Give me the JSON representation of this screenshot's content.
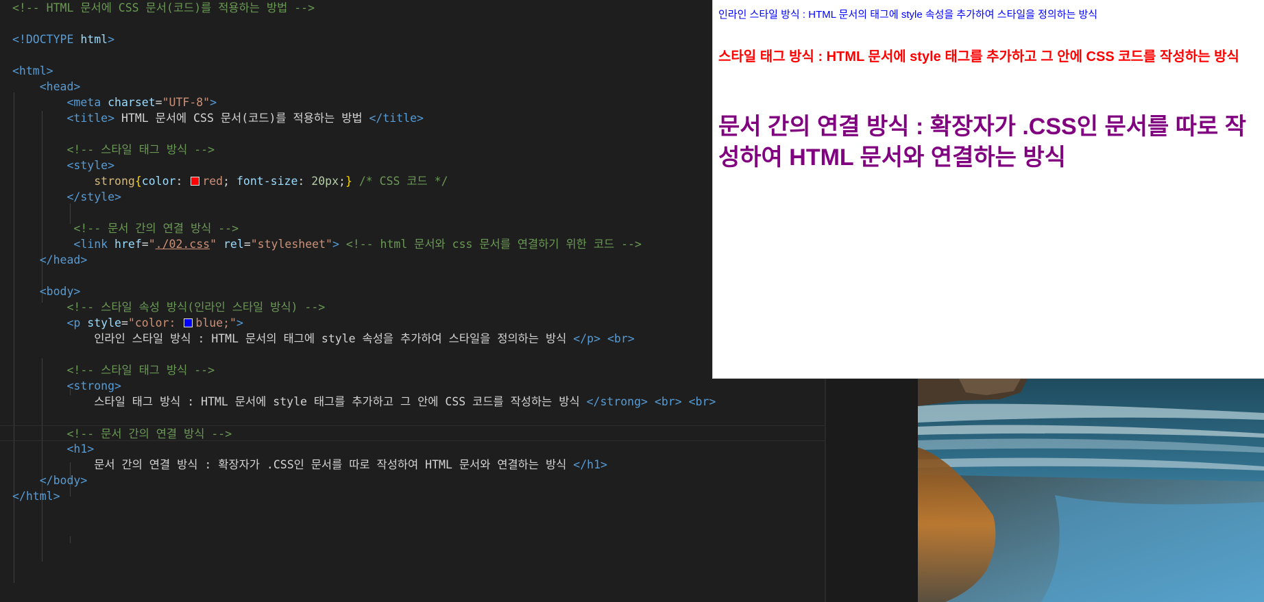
{
  "editor": {
    "lines": [
      [
        [
          "com",
          "<!-- HTML 문서에 CSS 문서(코드)를 적용하는 방법 -->"
        ]
      ],
      [],
      [
        [
          "tag",
          "<!"
        ],
        [
          "tag",
          "DOCTYPE"
        ],
        [
          "txt",
          " "
        ],
        [
          "attr",
          "html"
        ],
        [
          "tag",
          ">"
        ]
      ],
      [],
      [
        [
          "tag",
          "<html>"
        ]
      ],
      [
        [
          "txt",
          "    "
        ],
        [
          "tag",
          "<head>"
        ]
      ],
      [
        [
          "txt",
          "        "
        ],
        [
          "tag",
          "<meta"
        ],
        [
          "txt",
          " "
        ],
        [
          "attr",
          "charset"
        ],
        [
          "txt",
          "="
        ],
        [
          "str",
          "\"UTF-8\""
        ],
        [
          "tag",
          ">"
        ]
      ],
      [
        [
          "txt",
          "        "
        ],
        [
          "tag",
          "<title>"
        ],
        [
          "txt",
          " HTML 문서에 CSS 문서(코드)를 적용하는 방법 "
        ],
        [
          "tag",
          "</title>"
        ]
      ],
      [],
      [
        [
          "txt",
          "        "
        ],
        [
          "com",
          "<!-- 스타일 태그 방식 -->"
        ]
      ],
      [
        [
          "txt",
          "        "
        ],
        [
          "tag",
          "<style>"
        ]
      ],
      [
        [
          "txt",
          "            "
        ],
        [
          "sel",
          "strong"
        ],
        [
          "brace",
          "{"
        ],
        [
          "prop",
          "color"
        ],
        [
          "txt",
          ": "
        ],
        [
          "swatch",
          "#ff0000"
        ],
        [
          "str",
          "red"
        ],
        [
          "txt",
          "; "
        ],
        [
          "prop",
          "font-size"
        ],
        [
          "txt",
          ": "
        ],
        [
          "num",
          "20px"
        ],
        [
          "txt",
          ";"
        ],
        [
          "brace",
          "}"
        ],
        [
          "txt",
          " "
        ],
        [
          "com",
          "/* CSS 코드 */"
        ]
      ],
      [
        [
          "txt",
          "        "
        ],
        [
          "tag",
          "</style>"
        ]
      ],
      [],
      [
        [
          "txt",
          "         "
        ],
        [
          "com",
          "<!-- 문서 간의 연결 방식 -->"
        ]
      ],
      [
        [
          "txt",
          "         "
        ],
        [
          "tag",
          "<link"
        ],
        [
          "txt",
          " "
        ],
        [
          "attr",
          "href"
        ],
        [
          "txt",
          "="
        ],
        [
          "str",
          "\""
        ],
        [
          "link",
          "./02.css"
        ],
        [
          "str",
          "\""
        ],
        [
          "txt",
          " "
        ],
        [
          "attr",
          "rel"
        ],
        [
          "txt",
          "="
        ],
        [
          "str",
          "\"stylesheet\""
        ],
        [
          "tag",
          ">"
        ],
        [
          "txt",
          " "
        ],
        [
          "com",
          "<!-- html 문서와 css 문서를 연결하기 위한 코드 -->"
        ]
      ],
      [
        [
          "txt",
          "    "
        ],
        [
          "tag",
          "</head>"
        ]
      ],
      [],
      [
        [
          "txt",
          "    "
        ],
        [
          "tag",
          "<body>"
        ]
      ],
      [
        [
          "txt",
          "        "
        ],
        [
          "com",
          "<!-- 스타일 속성 방식(인라인 스타일 방식) -->"
        ]
      ],
      [
        [
          "txt",
          "        "
        ],
        [
          "tag",
          "<p"
        ],
        [
          "txt",
          " "
        ],
        [
          "attr",
          "style"
        ],
        [
          "txt",
          "="
        ],
        [
          "str",
          "\"color: "
        ],
        [
          "swatch",
          "#0000ff"
        ],
        [
          "str",
          "blue;\""
        ],
        [
          "tag",
          ">"
        ]
      ],
      [
        [
          "txt",
          "            인라인 스타일 방식 : HTML 문서의 태그에 style 속성을 추가하여 스타일을 정의하는 방식 "
        ],
        [
          "tag",
          "</p>"
        ],
        [
          "txt",
          " "
        ],
        [
          "tag",
          "<br>"
        ]
      ],
      [],
      [
        [
          "txt",
          "        "
        ],
        [
          "com",
          "<!-- 스타일 태그 방식 -->"
        ]
      ],
      [
        [
          "txt",
          "        "
        ],
        [
          "tag",
          "<strong>"
        ]
      ],
      [
        [
          "txt",
          "            스타일 태그 방식 : HTML 문서에 style 태그를 추가하고 그 안에 CSS 코드를 작성하는 방식 "
        ],
        [
          "tag",
          "</strong>"
        ],
        [
          "txt",
          " "
        ],
        [
          "tag",
          "<br>"
        ],
        [
          "txt",
          " "
        ],
        [
          "tag",
          "<br>"
        ]
      ],
      [],
      [
        [
          "txt",
          "        "
        ],
        [
          "com",
          "<!-- 문서 간의 연결 방식 -->"
        ]
      ],
      [
        [
          "txt",
          "        "
        ],
        [
          "tag",
          "<h1>"
        ]
      ],
      [
        [
          "txt",
          "            문서 간의 연결 방식 : 확장자가 .CSS인 문서를 따로 작성하여 HTML 문서와 연결하는 방식 "
        ],
        [
          "tag",
          "</h1>"
        ]
      ],
      [
        [
          "txt",
          "    "
        ],
        [
          "tag",
          "</body>"
        ]
      ],
      [
        [
          "tag",
          "</html>"
        ]
      ]
    ],
    "current_line": 27
  },
  "preview": {
    "inline_text": "인라인 스타일 방식 : HTML 문서의 태그에 style 속성을 추가하여 스타일을 정의하는 방식",
    "strong_text": "스타일 태그 방식 : HTML 문서에 style 태그를 추가하고 그 안에 CSS 코드를 작성하는 방식",
    "h1_text": "문서 간의 연결 방식 : 확장자가 .CSS인 문서를 따로 작성하여 HTML 문서와 연결하는 방식"
  },
  "colors": {
    "editor_bg": "#1e1e1e",
    "inline_blue": "#0000ff",
    "strong_red": "#ff0000",
    "h1_purple": "#800080"
  }
}
